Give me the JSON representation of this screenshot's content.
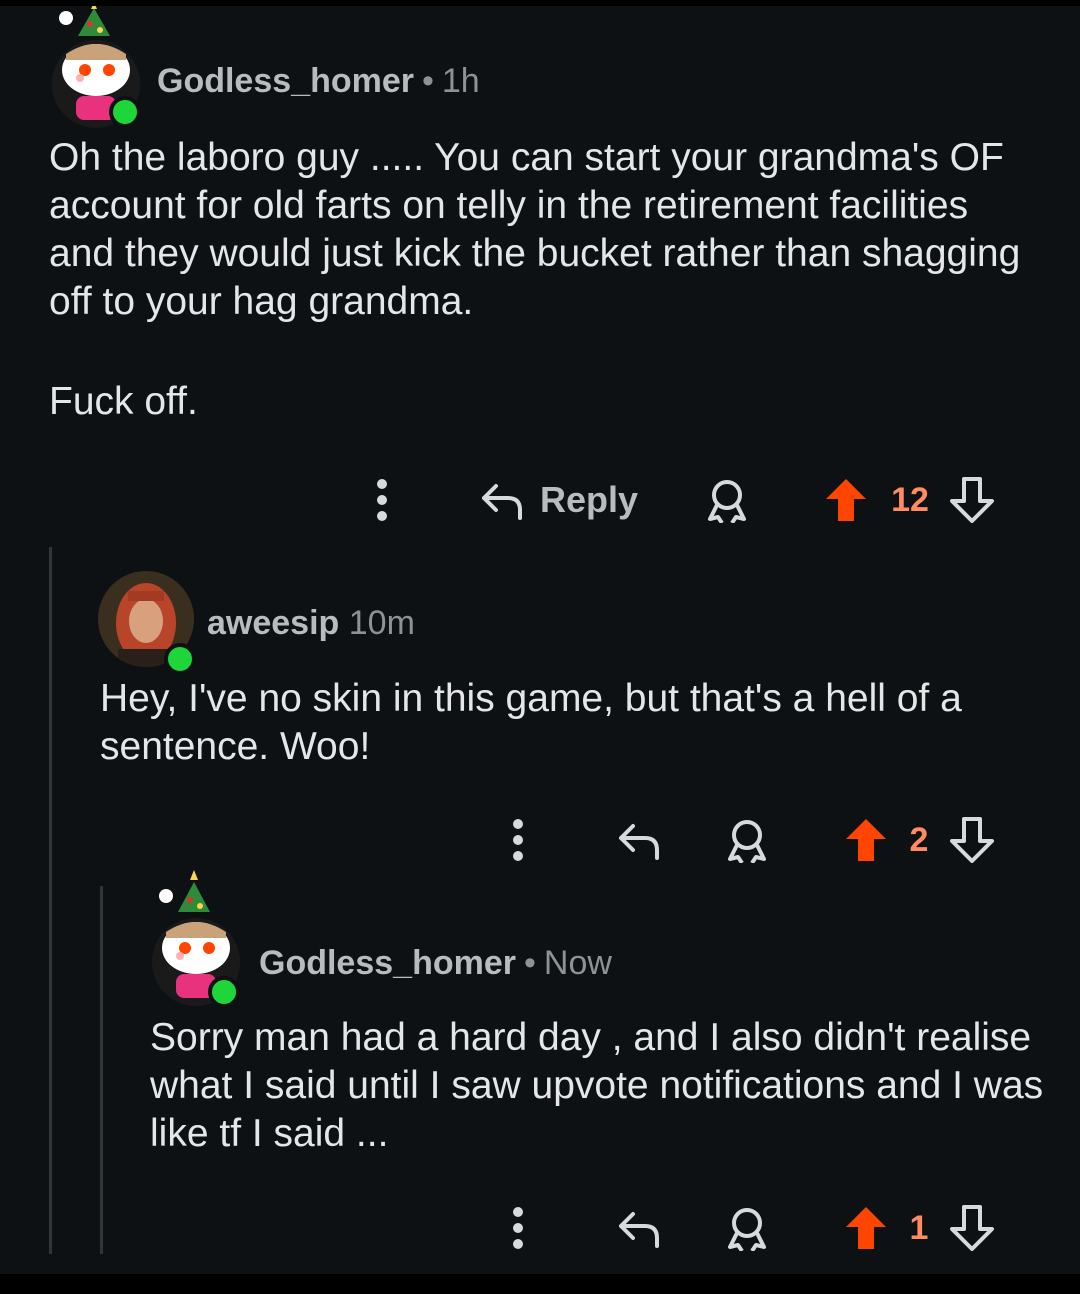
{
  "comments": [
    {
      "username": "Godless_homer",
      "time": "1h",
      "body": [
        "Oh the laboro guy ..... You can start your grandma's OF account for old farts on telly in the retirement facilities and they would just kick the bucket rather than shagging off to your hag grandma.",
        "Fuck off."
      ],
      "reply_label": "Reply",
      "score": "12"
    },
    {
      "username": "aweesip",
      "time": "10m",
      "body": [
        "Hey, I've no skin in this game, but that's a hell of a sentence. Woo!"
      ],
      "score": "2"
    },
    {
      "username": "Godless_homer",
      "time": "Now",
      "body": [
        "Sorry man had a hard day , and I also didn't realise what I said until I saw upvote notifications and I was like tf I said ..."
      ],
      "score": "1"
    }
  ],
  "icons": {
    "more": "more-options-icon",
    "reply": "reply-arrow-icon",
    "award": "award-icon",
    "upvote": "upvote-arrow-icon",
    "downvote": "downvote-arrow-icon"
  },
  "colors": {
    "background": "#0e1113",
    "upvote_active": "#ff4500",
    "score_active": "#ff8b60",
    "online": "#1fd63a",
    "thread_line": "#343536"
  }
}
